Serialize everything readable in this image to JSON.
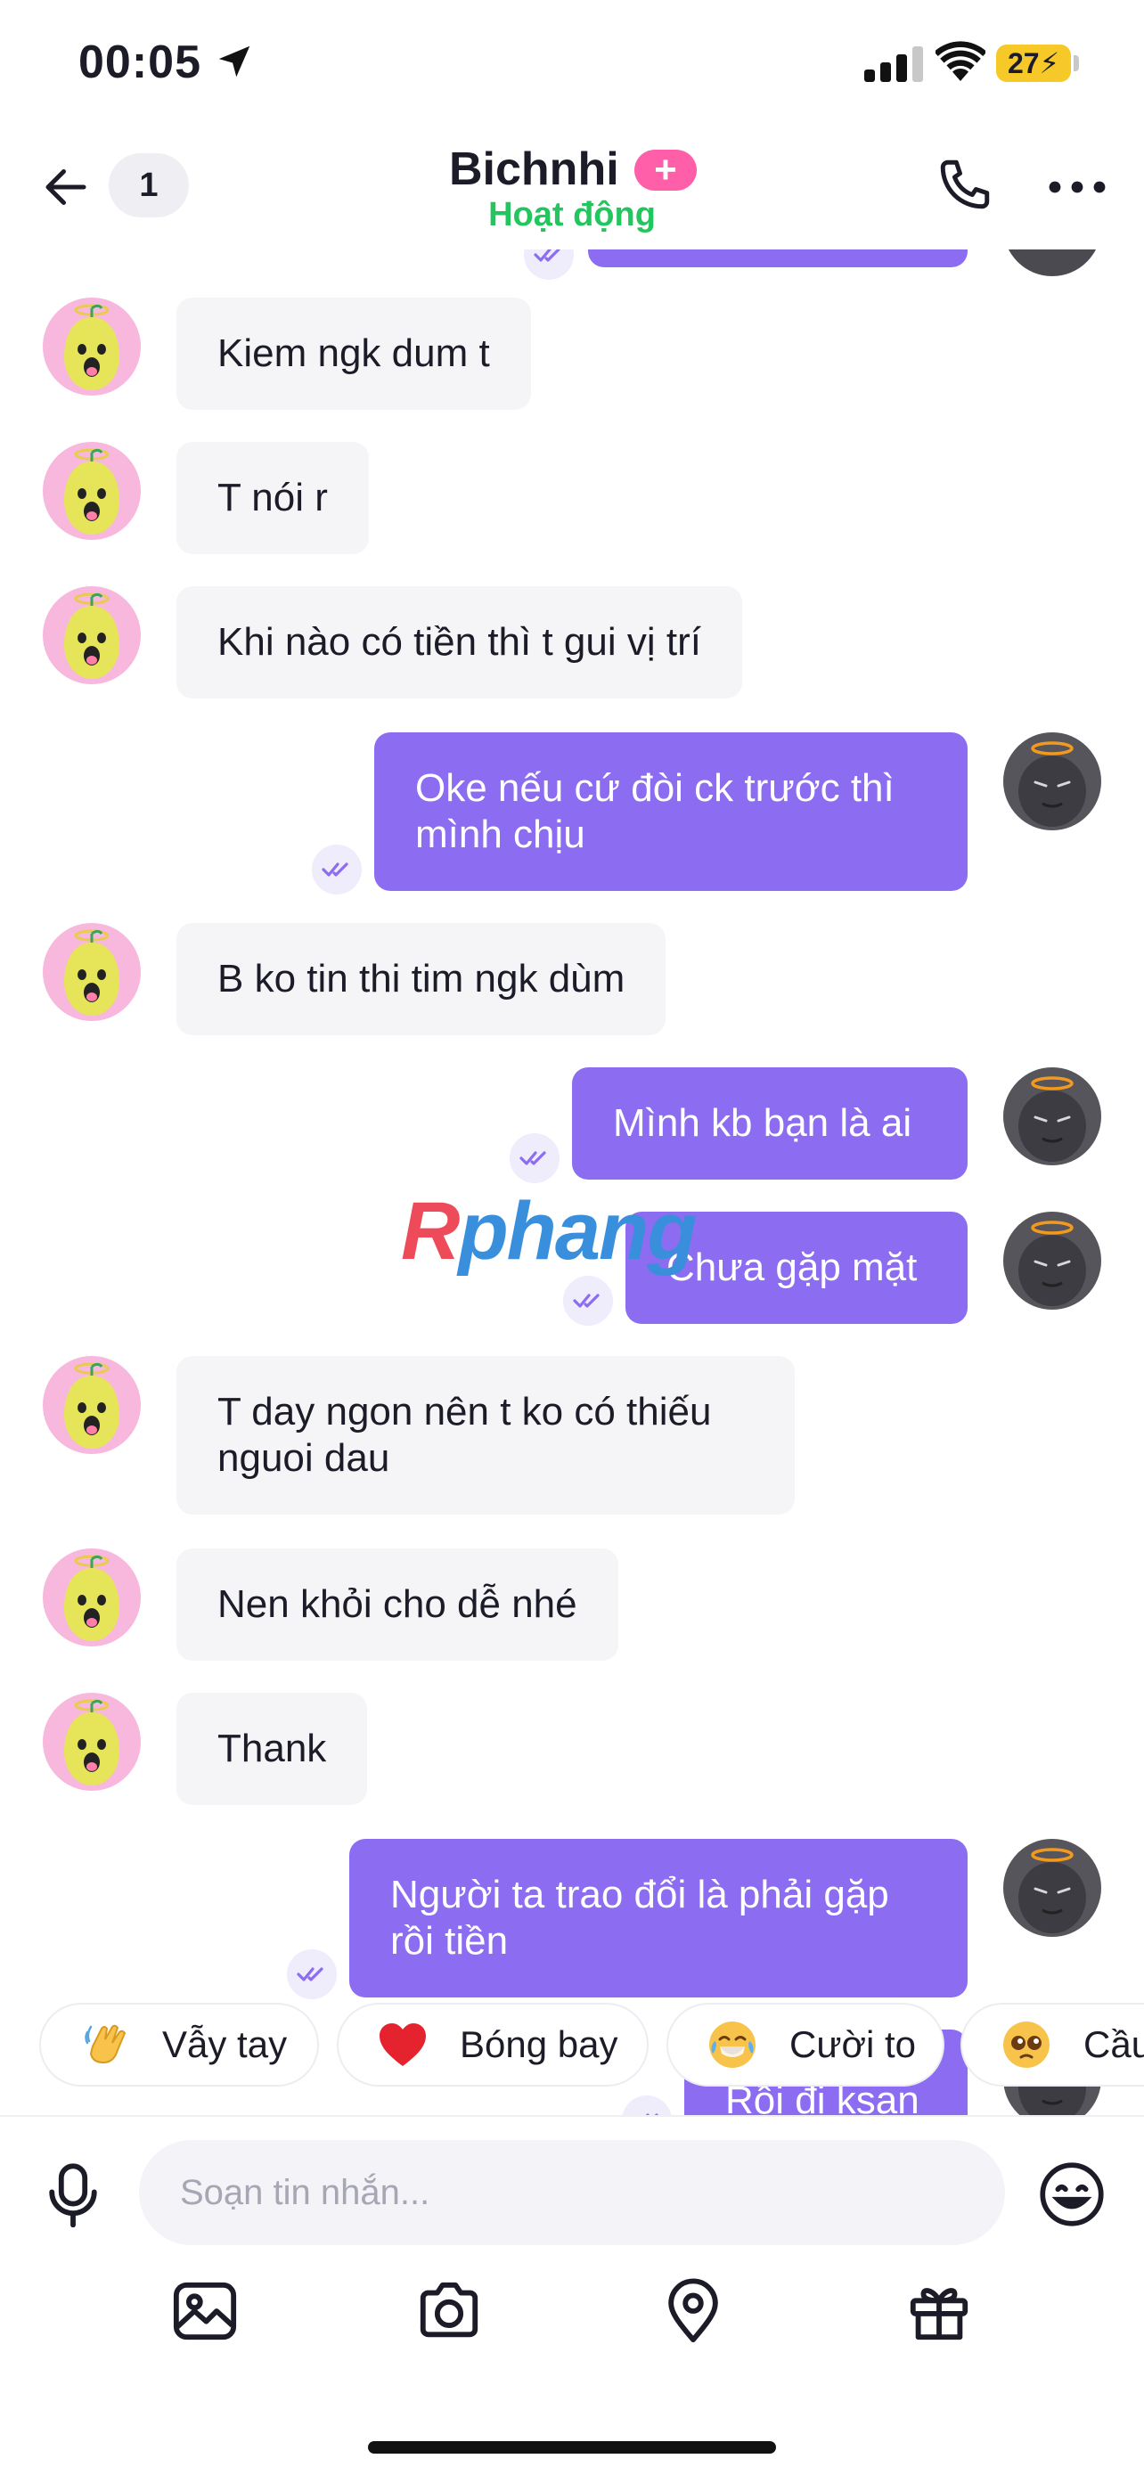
{
  "status_bar": {
    "time": "00:05",
    "battery": "27"
  },
  "header": {
    "back_count": "1",
    "contact_name": "Bichnhi",
    "plus_badge": "+",
    "status": "Hoạt động"
  },
  "messages": [
    {
      "dir": "in",
      "text": "Kiem ngk dum t"
    },
    {
      "dir": "in",
      "text": "T nói r"
    },
    {
      "dir": "in",
      "text": "Khi nào có tiền thì t gui vị trí"
    },
    {
      "dir": "out",
      "text": "Oke nếu cứ đòi ck trước thì mình chịu"
    },
    {
      "dir": "in",
      "text": "B ko tin thi tim ngk dùm"
    },
    {
      "dir": "out",
      "text": "Mình kb bạn là ai"
    },
    {
      "dir": "out",
      "text": "Chưa gặp mặt"
    },
    {
      "dir": "in",
      "text": "T day ngon nên t ko có thiếu nguoi dau"
    },
    {
      "dir": "in",
      "text": "Nen khỏi cho dễ nhé"
    },
    {
      "dir": "in",
      "text": "Thank"
    },
    {
      "dir": "out",
      "text": "Người ta trao đổi là phải gặp rồi tiền"
    },
    {
      "dir": "out",
      "text": "Rồi đi ksan"
    }
  ],
  "watermark": {
    "part1": "R",
    "part2": "phang"
  },
  "quick_reactions": [
    {
      "label": "Vẫy tay",
      "icon": "waving-hand-icon"
    },
    {
      "label": "Bóng bay",
      "icon": "red-heart-icon"
    },
    {
      "label": "Cười to",
      "icon": "tears-of-joy-icon"
    },
    {
      "label": "Cầu",
      "icon": "pleading-face-icon"
    }
  ],
  "composer": {
    "placeholder": "Soạn tin nhắn..."
  },
  "toolbar": [
    "image-icon",
    "camera-icon",
    "location-icon",
    "gift-icon"
  ],
  "colors": {
    "outgoing_bubble": "#8c6cf0",
    "incoming_bubble": "#f5f5f8",
    "status_green": "#22c55e",
    "plus_pink": "#ff5fa8"
  }
}
